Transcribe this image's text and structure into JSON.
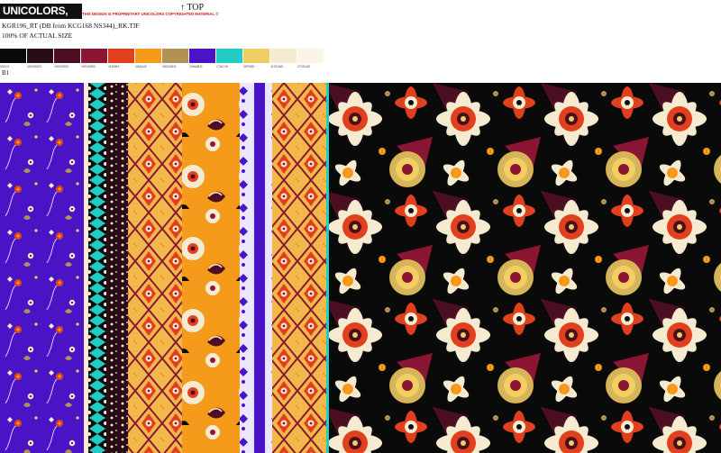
{
  "brand": {
    "logo_text": "UNICOLORS, INC."
  },
  "orientation": {
    "label": "TOP",
    "arrow": "↑"
  },
  "legal_notice": "THIS DESIGN IS PROPRIETARY UNICOLORS COPYRIGHTED MATERIAL ©",
  "file": {
    "name": "KGR196_RT (DB from KCG168 NS344)_RK.TIF",
    "scale": "100% OF ACTUAL SIZE"
  },
  "variant": "B1",
  "palette": [
    {
      "hex": "#0a0a0a",
      "code": "0001X"
    },
    {
      "hex": "#2a0c16",
      "code": "19040303"
    },
    {
      "hex": "#4c0f22",
      "code": "19020503"
    },
    {
      "hex": "#8a1634",
      "code": "19040802"
    },
    {
      "hex": "#e2401d",
      "code": "1160N3"
    },
    {
      "hex": "#f59a1a",
      "code": "15AA42"
    },
    {
      "hex": "#b39156",
      "code": "16010811"
    },
    {
      "hex": "#4a14c6",
      "code": "19AAB11"
    },
    {
      "hex": "#22ccc6",
      "code": "17AC19"
    },
    {
      "hex": "#f1ce63",
      "code": "40FA50"
    },
    {
      "hex": "#f6ead0",
      "code": "11010A5"
    },
    {
      "hex": "#fbf5e8",
      "code": "27101A2"
    }
  ]
}
